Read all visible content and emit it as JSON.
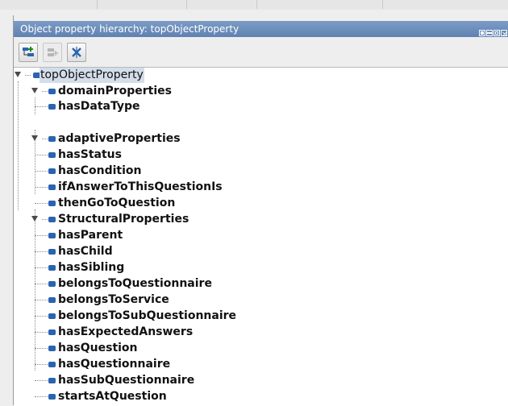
{
  "panel": {
    "title": "Object property hierarchy: topObjectProperty"
  },
  "toolbar": {
    "buttons": [
      {
        "name": "add-subproperty",
        "icon": "add-subproperty-icon",
        "enabled": true
      },
      {
        "name": "add-sibling-property",
        "icon": "add-sibling-property-icon",
        "enabled": false
      },
      {
        "name": "delete-property",
        "icon": "delete-property-icon",
        "enabled": true
      }
    ]
  },
  "colors": {
    "titlebar": "#6a8cbb",
    "property_icon": "#2a64b0",
    "selection": "#d4ddea"
  },
  "tree": {
    "root": "topObjectProperty",
    "groups": [
      {
        "label": "domainProperties",
        "children": [
          "hasDataType"
        ]
      },
      {
        "label": "adaptiveProperties",
        "children": [
          "hasStatus",
          "hasCondition",
          "ifAnswerToThisQuestionIs",
          "thenGoToQuestion"
        ]
      },
      {
        "label": "StructuralProperties",
        "children": [
          "hasParent",
          "hasChild",
          "hasSibling",
          "belongsToQuestionnaire",
          "belongsToService",
          "belongsToSubQuestionnaire",
          "hasExpectedAnswers",
          "hasQuestion",
          "hasQuestionnaire",
          "hasSubQuestionnaire",
          "startsAtQuestion"
        ]
      }
    ]
  }
}
